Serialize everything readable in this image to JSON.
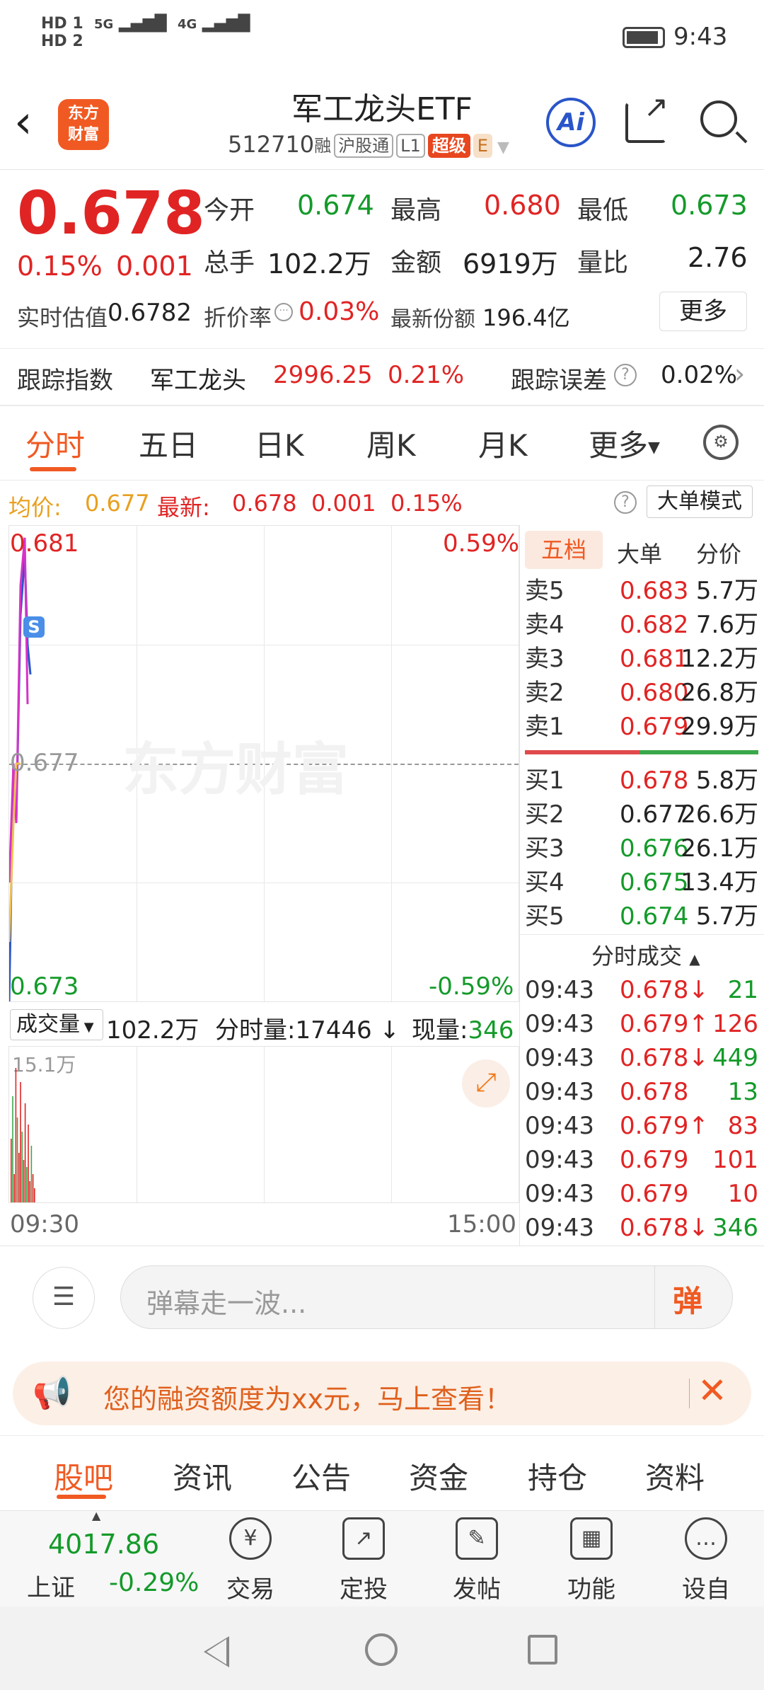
{
  "status": {
    "left_icons": "HD1 HD2 5G 4G",
    "time": "9:43"
  },
  "header": {
    "logo_text": "东方\n财富",
    "title": "军工龙头ETF",
    "code": "512710",
    "tags": [
      "融",
      "沪股通",
      "L1",
      "超级",
      "E"
    ]
  },
  "quote": {
    "price": "0.678",
    "change_pct": "0.15%",
    "change": "0.001",
    "items": [
      {
        "label": "今开",
        "value": "0.674",
        "color": "green"
      },
      {
        "label": "最高",
        "value": "0.680",
        "color": "red"
      },
      {
        "label": "最低",
        "value": "0.673",
        "color": "green"
      },
      {
        "label": "总手",
        "value": "102.2万",
        "color": "dark"
      },
      {
        "label": "金额",
        "value": "6919万",
        "color": "dark"
      },
      {
        "label": "量比",
        "value": "2.76",
        "color": "dark"
      }
    ],
    "est_label": "实时估值",
    "est_value": "0.6782",
    "discount_label": "折价率",
    "discount_value": "0.03%",
    "share_label": "最新份额",
    "share_value": "196.4亿",
    "more_label": "更多"
  },
  "tracking": {
    "label": "跟踪指数",
    "index": "军工龙头",
    "index_value": "2996.25",
    "index_pct": "0.21%",
    "error_label": "跟踪误差",
    "error_value": "0.02%"
  },
  "tabs": [
    "分时",
    "五日",
    "日K",
    "周K",
    "月K",
    "更多"
  ],
  "chart_header": {
    "avg_label": "均价:",
    "avg_value": "0.677",
    "latest_label": "最新:",
    "latest_value": "0.678",
    "latest_change": "0.001",
    "latest_pct": "0.15%",
    "mode_label": "大单模式"
  },
  "chart_data": {
    "type": "line",
    "y_top": "0.681",
    "y_top_pct": "0.59%",
    "y_mid": "0.677",
    "y_bottom": "0.673",
    "y_bottom_pct": "-0.59%",
    "x_start": "09:30",
    "x_end": "15:00",
    "watermark": "东方财富",
    "ylim": [
      0.673,
      0.681
    ],
    "series": [
      {
        "color": "#2a55c9",
        "values": [
          0.673,
          0.677,
          0.676,
          0.6795,
          0.6805,
          0.679,
          0.6785
        ]
      },
      {
        "color": "#d633c8",
        "values": [
          0.675,
          0.677,
          0.676,
          0.68,
          0.6808,
          0.678
        ]
      },
      {
        "color": "#f0c050",
        "values": [
          0.674,
          0.676,
          0.677,
          0.677
        ]
      }
    ]
  },
  "volume": {
    "label": "成交量",
    "total": "102.2万",
    "minute_label": "分时量:",
    "minute_value": "17446",
    "now_label": "现量:",
    "now_value": "346",
    "scale": "15.1万"
  },
  "orderbook": {
    "tabs": [
      "五档",
      "大单",
      "分价"
    ],
    "asks": [
      {
        "label": "卖5",
        "price": "0.683",
        "vol": "5.7万"
      },
      {
        "label": "卖4",
        "price": "0.682",
        "vol": "7.6万"
      },
      {
        "label": "卖3",
        "price": "0.681",
        "vol": "12.2万"
      },
      {
        "label": "卖2",
        "price": "0.680",
        "vol": "26.8万"
      },
      {
        "label": "卖1",
        "price": "0.679",
        "vol": "29.9万"
      }
    ],
    "bids": [
      {
        "label": "买1",
        "price": "0.678",
        "vol": "5.8万",
        "color": "red"
      },
      {
        "label": "买2",
        "price": "0.677",
        "vol": "26.6万",
        "color": "dark"
      },
      {
        "label": "买3",
        "price": "0.676",
        "vol": "26.1万",
        "color": "green"
      },
      {
        "label": "买4",
        "price": "0.675",
        "vol": "13.4万",
        "color": "green"
      },
      {
        "label": "买5",
        "price": "0.674",
        "vol": "5.7万",
        "color": "green"
      }
    ]
  },
  "trades": {
    "title": "分时成交",
    "rows": [
      {
        "time": "09:43",
        "price": "0.678↓",
        "vol": "21",
        "pc": "red",
        "vc": "green"
      },
      {
        "time": "09:43",
        "price": "0.679↑",
        "vol": "126",
        "pc": "red",
        "vc": "red"
      },
      {
        "time": "09:43",
        "price": "0.678↓",
        "vol": "449",
        "pc": "red",
        "vc": "green"
      },
      {
        "time": "09:43",
        "price": "0.678",
        "vol": "13",
        "pc": "red",
        "vc": "green"
      },
      {
        "time": "09:43",
        "price": "0.679↑",
        "vol": "83",
        "pc": "red",
        "vc": "red"
      },
      {
        "time": "09:43",
        "price": "0.679",
        "vol": "101",
        "pc": "red",
        "vc": "red"
      },
      {
        "time": "09:43",
        "price": "0.679",
        "vol": "10",
        "pc": "red",
        "vc": "red"
      },
      {
        "time": "09:43",
        "price": "0.678↓",
        "vol": "346",
        "pc": "red",
        "vc": "green"
      }
    ]
  },
  "danmu": {
    "placeholder": "弹幕走一波...",
    "send_label": "弹"
  },
  "banner": {
    "text": "您的融资额度为xx元，马上查看！"
  },
  "subtabs": [
    "股吧",
    "资讯",
    "公告",
    "资金",
    "持仓",
    "资料"
  ],
  "bottom": {
    "index_value": "4017.86",
    "index_name": "上证",
    "index_pct": "-0.29%",
    "items": [
      {
        "label": "交易",
        "icon": "¥"
      },
      {
        "label": "定投",
        "icon": "↗"
      },
      {
        "label": "发帖",
        "icon": "✎"
      },
      {
        "label": "功能",
        "icon": "▦"
      },
      {
        "label": "设自选",
        "icon": "…"
      }
    ]
  },
  "colors": {
    "red": "#e02424",
    "green": "#149a2a",
    "accent": "#f05a22",
    "line_blue": "#2a55c9",
    "line_magenta": "#d633c8",
    "line_yellow": "#f0c050"
  }
}
